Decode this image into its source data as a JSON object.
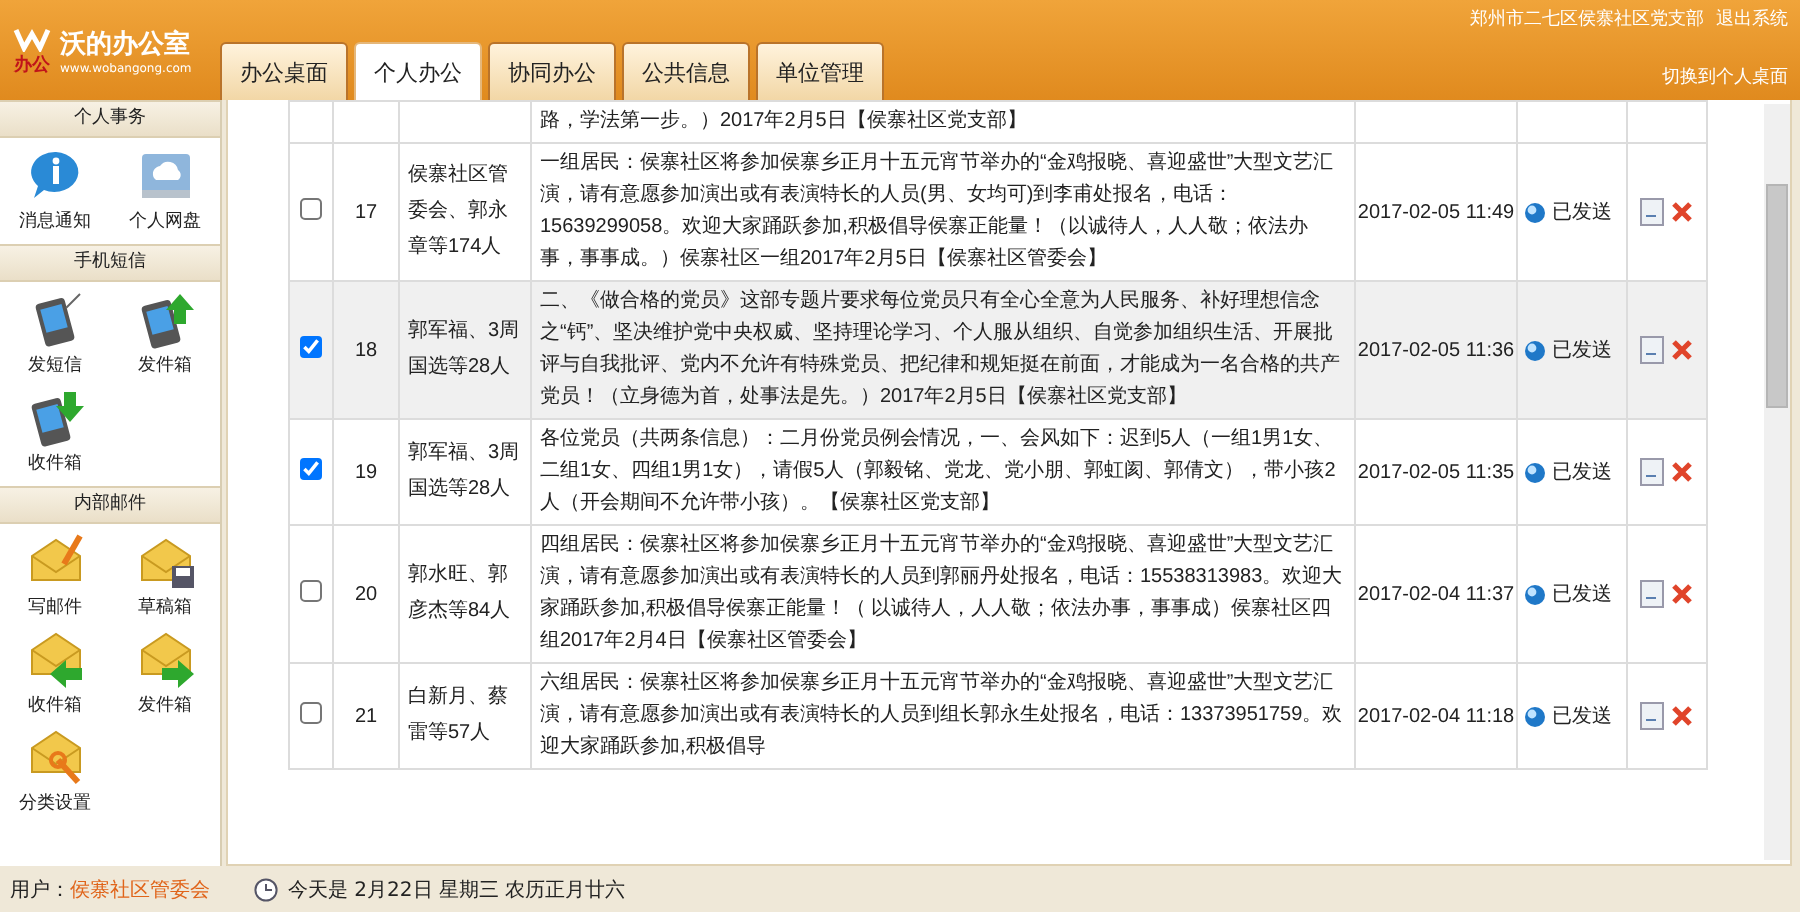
{
  "app": {
    "title": "沃的办公室",
    "url": "www.wobangong.com",
    "logo_text": "办公"
  },
  "tabs": [
    {
      "label": "办公桌面",
      "selected": false
    },
    {
      "label": "个人办公",
      "selected": true
    },
    {
      "label": "协同办公",
      "selected": false
    },
    {
      "label": "公共信息",
      "selected": false
    },
    {
      "label": "单位管理",
      "selected": false
    }
  ],
  "top_links": {
    "org": "郑州市二七区侯寨社区党支部",
    "logout": "退出系统",
    "switch": "切换到个人桌面"
  },
  "sidebar": {
    "sections": [
      {
        "title": "个人事务",
        "items": [
          {
            "label": "消息通知",
            "kind": "info"
          },
          {
            "label": "个人网盘",
            "kind": "disk"
          }
        ]
      },
      {
        "title": "手机短信",
        "items": [
          {
            "label": "发短信",
            "kind": "phone"
          },
          {
            "label": "发件箱",
            "kind": "phone-up"
          },
          {
            "label": "收件箱",
            "kind": "phone-down"
          }
        ]
      },
      {
        "title": "内部邮件",
        "items": [
          {
            "label": "写邮件",
            "kind": "mail-write"
          },
          {
            "label": "草稿箱",
            "kind": "mail-save"
          },
          {
            "label": "收件箱",
            "kind": "mail-in"
          },
          {
            "label": "发件箱",
            "kind": "mail-out"
          },
          {
            "label": "分类设置",
            "kind": "mail-settings"
          }
        ]
      }
    ]
  },
  "messages": {
    "continued_text": "路，学法第一步。）2017年2月5日【侯寨社区党支部】",
    "rows": [
      {
        "checked": false,
        "highlighted": false,
        "number": "17",
        "recipients": "侯寨社区管委会、郭永章等174人",
        "content": "一组居民：侯寨社区将参加侯寨乡正月十五元宵节举办的“金鸡报晓、喜迎盛世”大型文艺汇演，请有意愿参加演出或有表演特长的人员(男、女均可)到李甫处报名，电话：15639299058。欢迎大家踊跃参加,积极倡导侯寨正能量！（以诚待人，人人敬；依法办事，事事成。）侯寨社区一组2017年2月5日【侯寨社区管委会】",
        "time": "2017-02-05 11:49",
        "status": "已发送"
      },
      {
        "checked": true,
        "highlighted": true,
        "number": "18",
        "recipients": "郭军福、3周国选等28人",
        "content": "二、《做合格的党员》这部专题片要求每位党员只有全心全意为人民服务、补好理想信念之“钙”、坚决维护党中央权威、坚持理论学习、个人服从组织、自觉参加组织生活、开展批评与自我批评、党内不允许有特殊党员、把纪律和规矩挺在前面，才能成为一名合格的共产党员！（立身德为首，处事法是先。）2017年2月5日【侯寨社区党支部】",
        "time": "2017-02-05 11:36",
        "status": "已发送"
      },
      {
        "checked": true,
        "highlighted": false,
        "number": "19",
        "recipients": "郭军福、3周国选等28人",
        "content": "各位党员（共两条信息）：二月份党员例会情况，一、会风如下：迟到5人（一组1男1女、二组1女、四组1男1女），请假5人（郭毅铭、党龙、党小朋、郭虹阂、郭倩文），带小孩2人（开会期间不允许带小孩）。【侯寨社区党支部】",
        "time": "2017-02-05 11:35",
        "status": "已发送"
      },
      {
        "checked": false,
        "highlighted": false,
        "number": "20",
        "recipients": "郭水旺、郭彦杰等84人",
        "content": "四组居民：侯寨社区将参加侯寨乡正月十五元宵节举办的“金鸡报晓、喜迎盛世”大型文艺汇演，请有意愿参加演出或有表演特长的人员到郭丽丹处报名，电话：15538313983。欢迎大家踊跃参加,积极倡导侯寨正能量！（ 以诚待人，人人敬；依法办事，事事成）侯寨社区四组2017年2月4日【侯寨社区管委会】",
        "time": "2017-02-04 11:37",
        "status": "已发送"
      },
      {
        "checked": false,
        "highlighted": false,
        "number": "21",
        "recipients": "白新月、蔡雷等57人",
        "content": "六组居民：侯寨社区将参加侯寨乡正月十五元宵节举办的“金鸡报晓、喜迎盛世”大型文艺汇演，请有意愿参加演出或有表演特长的人员到组长郭永生处报名，电话：13373951759。欢迎大家踊跃参加,积极倡导",
        "time": "2017-02-04 11:18",
        "status": "已发送"
      }
    ]
  },
  "footer": {
    "user_label": "用户：",
    "user": "侯寨社区管委会",
    "date": "今天是 2月22日 星期三 农历正月廿六"
  }
}
